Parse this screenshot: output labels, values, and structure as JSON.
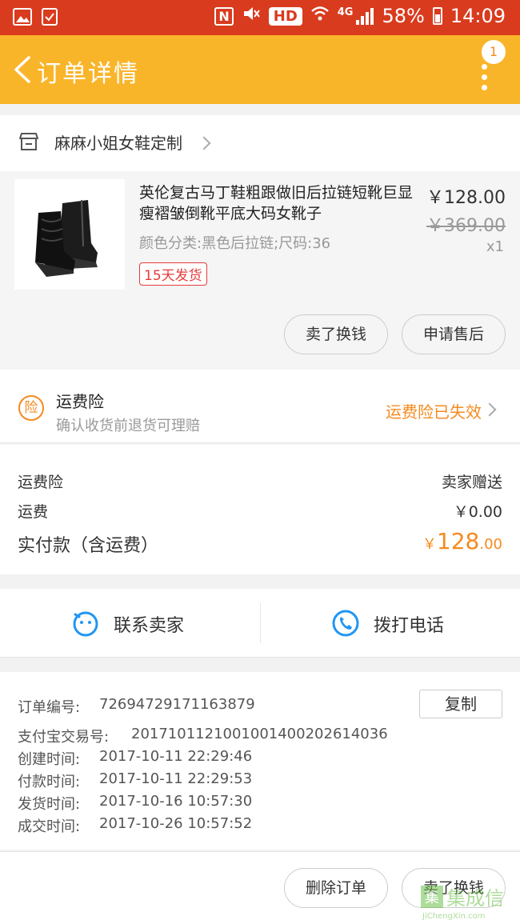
{
  "status_bar": {
    "signal_type": "4G",
    "battery": "58%",
    "time": "14:09",
    "hd": "HD",
    "nfc": "N"
  },
  "header": {
    "title": "订单详情",
    "badge_count": "1"
  },
  "shop": {
    "name": "麻麻小姐女鞋定制"
  },
  "product": {
    "title": "英伦复古马丁鞋粗跟做旧后拉链短靴巨显瘦褶皱倒靴平底大码女靴子",
    "sku": "颜色分类:黑色后拉链;尺码:36",
    "shipping_tag": "15天发货",
    "price": "￥128.00",
    "original_price": "￥369.00",
    "quantity": "x1",
    "buttons": [
      "卖了换钱",
      "申请售后"
    ]
  },
  "insurance": {
    "title": "运费险",
    "subtitle": "确认收货前退货可理赔",
    "icon_char": "险",
    "status": "运费险已失效"
  },
  "fees": {
    "insurance_label": "运费险",
    "insurance_value": "卖家赠送",
    "shipping_label": "运费",
    "shipping_value": "￥0.00",
    "total_label": "实付款（含运费）",
    "total_currency": "￥",
    "total_integer": "128",
    "total_decimal": ".00"
  },
  "contact": {
    "seller": "联系卖家",
    "phone": "拨打电话"
  },
  "order_info": {
    "order_no_label": "订单编号:",
    "order_no": "72694729171163879",
    "copy_label": "复制",
    "alipay_label": "支付宝交易号:",
    "alipay_no": "2017101121001001400202614036",
    "rows": [
      {
        "label": "创建时间:",
        "value": "2017-10-11 22:29:46"
      },
      {
        "label": "付款时间:",
        "value": "2017-10-11 22:29:53"
      },
      {
        "label": "发货时间:",
        "value": "2017-10-16 10:57:30"
      },
      {
        "label": "成交时间:",
        "value": "2017-10-26 10:57:52"
      }
    ]
  },
  "bottom_bar": {
    "delete_label": "删除订单",
    "sell_label": "卖了换钱"
  },
  "watermark": {
    "cn": "集成信",
    "en": "JiChengXin.com"
  },
  "colors": {
    "status_bar": "#d93b1e",
    "header": "#f9b52a",
    "accent_orange": "#f58a1f",
    "tag_red": "#e43b3b",
    "icon_blue": "#2196f3"
  }
}
